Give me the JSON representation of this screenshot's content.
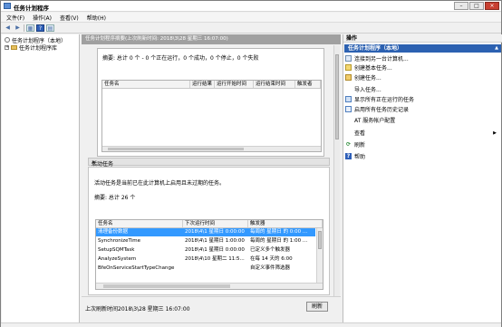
{
  "window": {
    "title": "任务计划程序",
    "buttons": {
      "minimize": "–",
      "maximize": "□",
      "close": "×"
    }
  },
  "menu": [
    "文件(F)",
    "操作(A)",
    "查看(V)",
    "帮助(H)"
  ],
  "toolbar": {
    "back": "◀",
    "forward": "▶",
    "show_tree": "▦",
    "help": "?",
    "properties": "▤"
  },
  "tree": {
    "root": "任务计划程序（本地）",
    "child": "任务计划程序库",
    "expand": "+"
  },
  "center": {
    "header": "任务计划程序摘要(上次刷新时间: 2018\\3\\28 星期三 16:07:00)",
    "status_summary": "摘要: 总计 0 个 - 0 个正在运行，0 个成功，0 个停止，0 个失败",
    "status_columns": [
      "任务名",
      "运行结果",
      "运行开始时间",
      "运行结束时间",
      "触发者"
    ],
    "active_section": {
      "label": "活动任务",
      "collapse": "▲",
      "description": "活动任务是当前已在此计算机上启用且未过期的任务。",
      "summary": "摘要: 总计 26 个",
      "columns": [
        "任务名",
        "下次运行时间",
        "触发器"
      ],
      "rows": [
        {
          "name": "清理备份数据",
          "next": "2018\\4\\1 星期日 0:00:00",
          "trigger": "每周的 星期日 的 0:00 ..."
        },
        {
          "name": "SynchronizeTime",
          "next": "2018\\4\\1 星期日 1:00:00",
          "trigger": "每周的 星期日 的 1:00 ..."
        },
        {
          "name": "SetupSQMTask",
          "next": "2018\\4\\1 星期日 0:00:00",
          "trigger": "已定义多个触发器"
        },
        {
          "name": "AnalyzeSystem",
          "next": "2018\\4\\10 星期二 11:5...",
          "trigger": "在每 14 天的 6:00"
        },
        {
          "name": "BfeOnServiceStartTypeChange",
          "next": "",
          "trigger": "自定义事件筛选器"
        }
      ]
    },
    "last_refresh": "上次刷新时间2018\\3\\28 星期三 16:07:00",
    "refresh_button": "刷新"
  },
  "actions": {
    "header": "操作",
    "section": "任务计划程序（本地）",
    "section_arrow": "▲",
    "items": [
      {
        "label": "连接到另一台计算机...",
        "icon": "connect-icon"
      },
      {
        "label": "创建基本任务...",
        "icon": "basic-task-icon"
      },
      {
        "label": "创建任务...",
        "icon": "create-task-icon"
      },
      {
        "label": "导入任务...",
        "icon": "import-icon"
      },
      {
        "label": "显示所有正在运行的任务",
        "icon": "running-tasks-icon"
      },
      {
        "label": "启用所有任务历史记录",
        "icon": "history-icon"
      },
      {
        "label": "AT 服务帐户配置",
        "icon": "at-service-icon"
      },
      {
        "label": "查看",
        "icon": "view-icon",
        "submenu": "▶"
      },
      {
        "label": "刷新",
        "icon": "refresh-icon"
      },
      {
        "label": "帮助",
        "icon": "help-icon"
      }
    ]
  }
}
